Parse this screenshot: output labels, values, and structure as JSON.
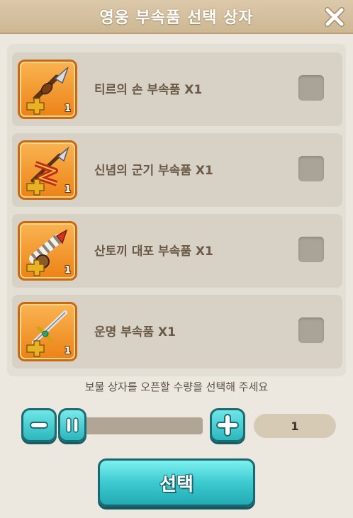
{
  "dialog": {
    "title": "영웅 부속품 선택 상자"
  },
  "items": [
    {
      "name": "티르의 손 부속품 X1",
      "qty": "1",
      "icon": "spear-key-icon"
    },
    {
      "name": "신념의 군기 부속품 X1",
      "qty": "1",
      "icon": "banner-key-icon"
    },
    {
      "name": "산토끼 대포 부속품 X1",
      "qty": "1",
      "icon": "cannon-key-icon"
    },
    {
      "name": "운명 부속품 X1",
      "qty": "1",
      "icon": "sword-key-icon"
    }
  ],
  "footer": {
    "hint": "보물 상자를 오픈할 수량을 선택해 주세요",
    "quantity": "1",
    "select_label": "선택"
  },
  "colors": {
    "accent": "#3ccad0",
    "title_bar": "#d3bf9d",
    "icon_bg": "#f2a03a"
  }
}
